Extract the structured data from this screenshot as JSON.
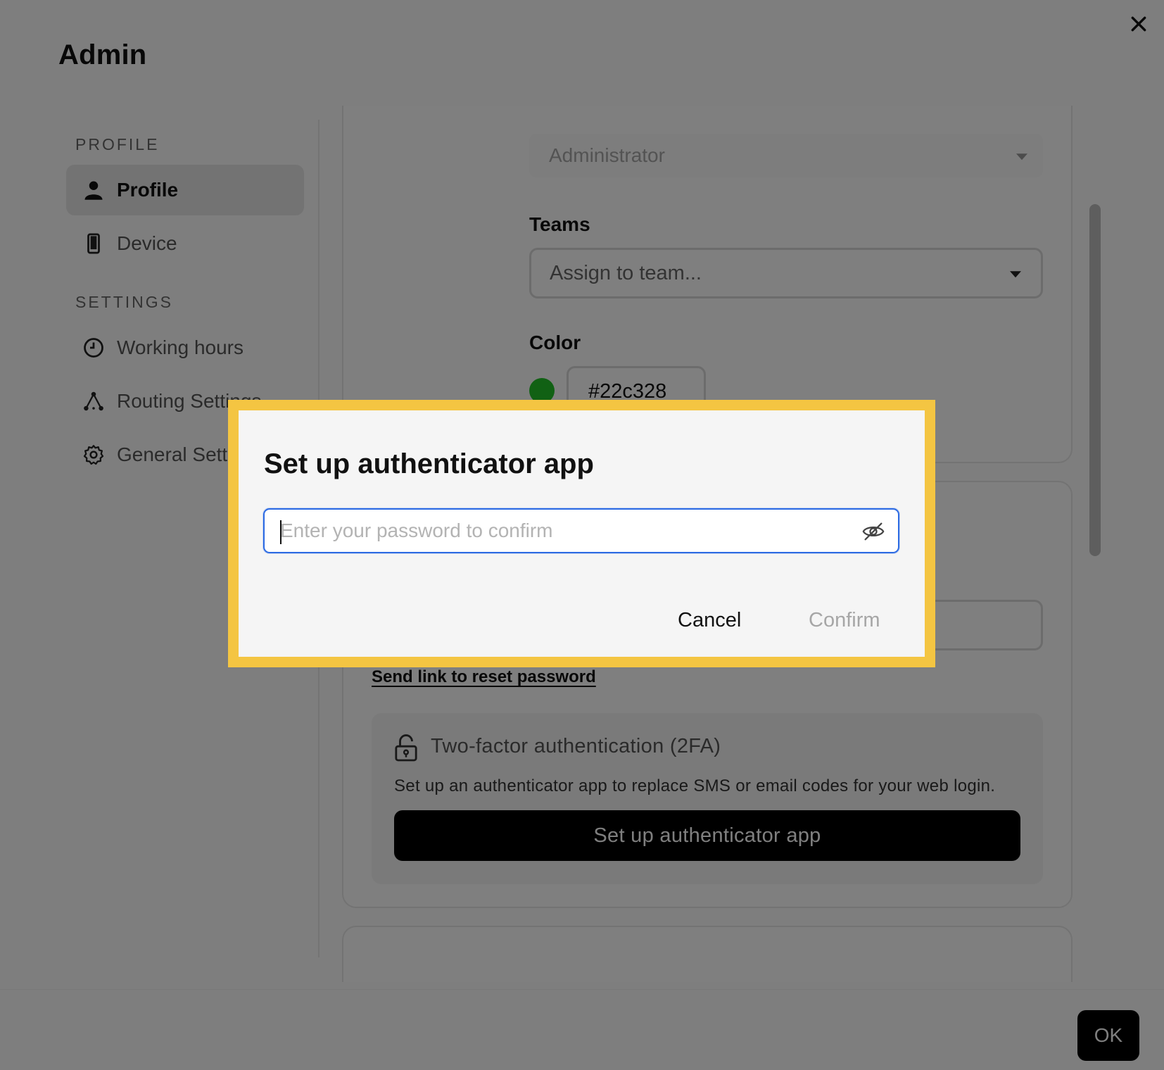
{
  "header": {
    "title": "Admin"
  },
  "sidebar": {
    "profile_section": "PROFILE",
    "settings_section": "SETTINGS",
    "items": [
      {
        "label": "Profile",
        "icon": "person-icon"
      },
      {
        "label": "Device",
        "icon": "mobile-device-icon"
      },
      {
        "label": "Working hours",
        "icon": "clock-icon"
      },
      {
        "label": "Routing Settings",
        "icon": "routing-nodes-icon"
      },
      {
        "label": "General Settings",
        "icon": "gear-icon"
      }
    ]
  },
  "main": {
    "role_select_value": "Administrator",
    "teams_label": "Teams",
    "teams_placeholder": "Assign to team...",
    "color_label": "Color",
    "color_value": "#22c328",
    "reset_link": "Send link to reset password",
    "twofa": {
      "title": "Two-factor authentication (2FA)",
      "description": "Set up an authenticator app to replace SMS or email codes for your web login.",
      "button": "Set up authenticator app"
    }
  },
  "footer": {
    "ok_label": "OK"
  },
  "modal": {
    "title": "Set up authenticator app",
    "password_placeholder": "Enter your password to confirm",
    "password_value": "",
    "cancel_label": "Cancel",
    "confirm_label": "Confirm"
  },
  "colors": {
    "highlight": "#f4c542",
    "focus": "#2d6be3",
    "team_color": "#22c328"
  }
}
